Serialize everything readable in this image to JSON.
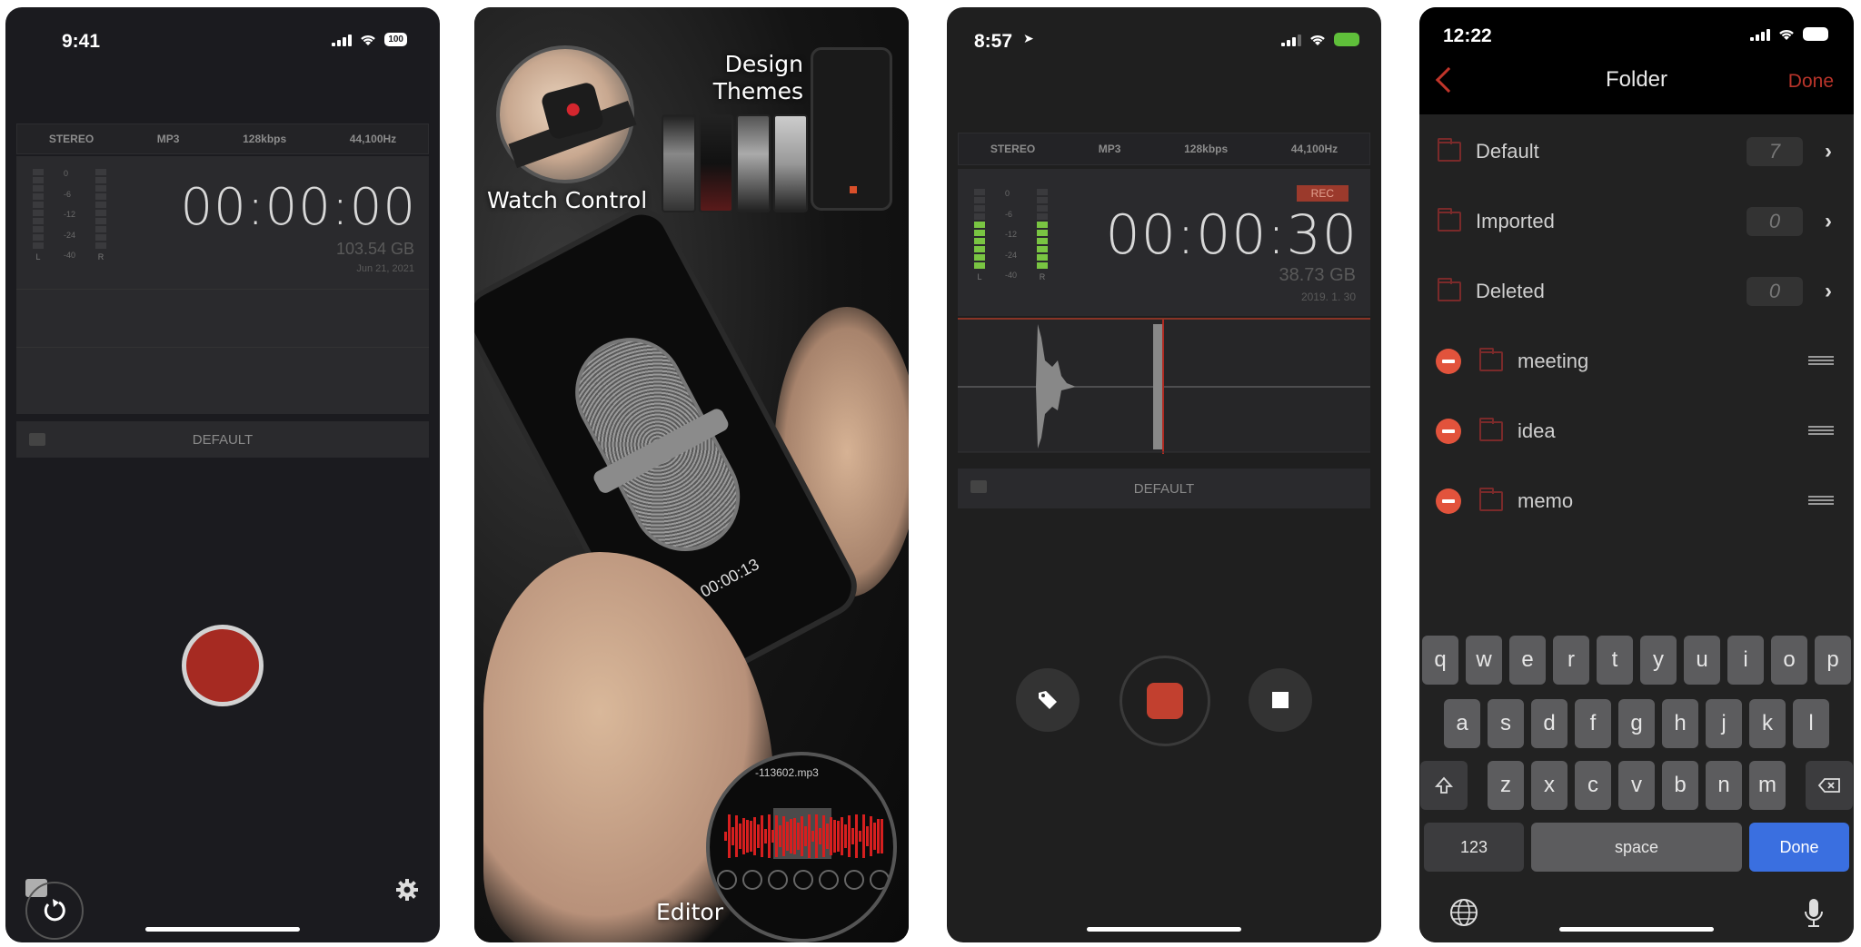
{
  "panel1": {
    "status": {
      "time": "9:41",
      "battery": "100"
    },
    "format": [
      "STEREO",
      "MP3",
      "128kbps",
      "44,100Hz"
    ],
    "meter": {
      "labels": [
        "0",
        "-6",
        "-12",
        "-24",
        "-40"
      ],
      "left_label": "L",
      "right_label": "R",
      "level_left": 0.0,
      "level_right": 0.0
    },
    "timer": "00:00:00",
    "storage": "103.54 GB",
    "date": "Jun 21, 2021",
    "folder": "DEFAULT",
    "icons": {
      "record": "record-icon",
      "undo": "undo-icon",
      "settings": "gear-icon"
    },
    "colors": {
      "record": "#a62a22"
    }
  },
  "panel2": {
    "captions": {
      "watch": "Watch Control",
      "design": "Design",
      "themes": "Themes",
      "editor": "Editor"
    },
    "phone_timer": "00:00:13",
    "editor_filename": "-113602.mp3"
  },
  "panel3": {
    "status": {
      "time": "8:57"
    },
    "format": [
      "STEREO",
      "MP3",
      "128kbps",
      "44,100Hz"
    ],
    "meter": {
      "labels": [
        "0",
        "-6",
        "-12",
        "-24",
        "-40"
      ],
      "left_label": "L",
      "right_label": "R",
      "level_left": 0.6,
      "level_right": 0.6
    },
    "rec_badge": "REC",
    "timer": "00:00:30",
    "storage": "38.73 GB",
    "date": "2019. 1. 30",
    "folder": "DEFAULT",
    "icons": {
      "tag": "tag-icon",
      "record": "record-stop-icon",
      "stop": "stop-icon"
    },
    "colors": {
      "meter_on": "#79c542",
      "record": "#c2402f"
    }
  },
  "panel4": {
    "status": {
      "time": "12:22"
    },
    "nav": {
      "title": "Folder",
      "done": "Done"
    },
    "fixed_folders": [
      {
        "name": "Default",
        "count": "7"
      },
      {
        "name": "Imported",
        "count": "0"
      },
      {
        "name": "Deleted",
        "count": "0"
      }
    ],
    "user_folders": [
      {
        "name": "meeting"
      },
      {
        "name": "idea"
      },
      {
        "name": "memo"
      }
    ],
    "keyboard": {
      "row1": [
        "q",
        "w",
        "e",
        "r",
        "t",
        "y",
        "u",
        "i",
        "o",
        "p"
      ],
      "row2": [
        "a",
        "s",
        "d",
        "f",
        "g",
        "h",
        "j",
        "k",
        "l"
      ],
      "row3": [
        "z",
        "x",
        "c",
        "v",
        "b",
        "n",
        "m"
      ],
      "numbers": "123",
      "space": "space",
      "done": "Done"
    },
    "colors": {
      "accent": "#b8342a",
      "done_key": "#3a6fe0"
    }
  }
}
